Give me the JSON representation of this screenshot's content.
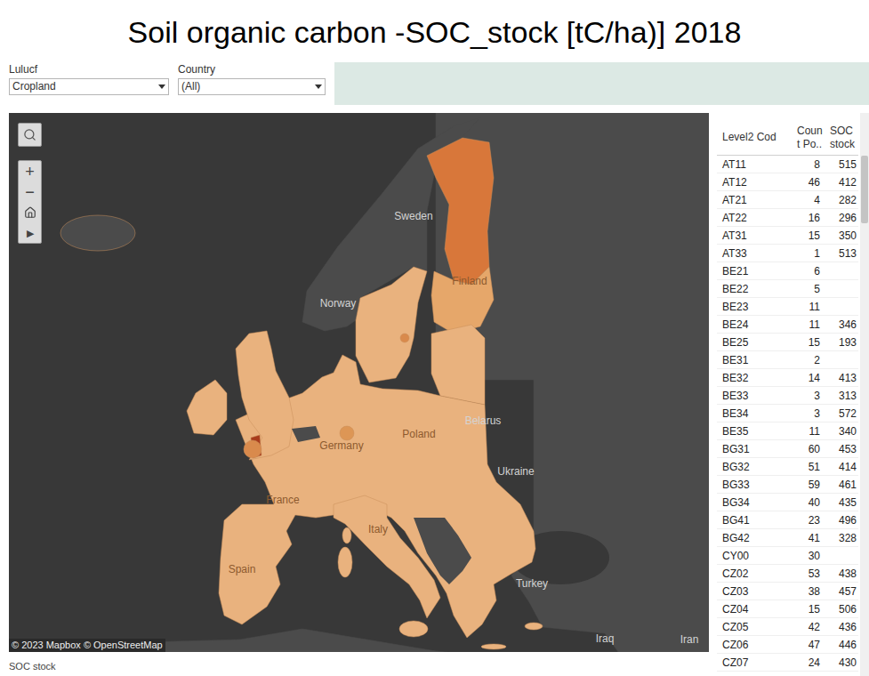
{
  "title": "Soil organic carbon -SOC_stock [tC/ha)] 2018",
  "filters": [
    {
      "label": "Lulucf",
      "value": "Cropland"
    },
    {
      "label": "Country",
      "value": "(All)"
    }
  ],
  "map": {
    "controls": {
      "zoom_in": "+",
      "zoom_out": "−",
      "play": "▶"
    },
    "attribution": "© 2023 Mapbox © OpenStreetMap",
    "regions": [
      {
        "color": "#d8773a"
      },
      {
        "color": "#e6a76a"
      },
      {
        "color": "#e9b27e"
      },
      {
        "color": "#e9b27e"
      },
      {
        "color": "#e9b27e"
      },
      {
        "color": "#e9b27e"
      },
      {
        "color": "#e9b27e"
      },
      {
        "color": "#e9b27e"
      },
      {
        "color": "#e9b27e"
      },
      {
        "color": "#e9b27e"
      },
      {
        "color": "#a83c1c"
      },
      {
        "color": "#e9b27e"
      },
      {
        "color": "#d98a4c"
      },
      {
        "color": "#dd9655"
      },
      {
        "color": "#d98a4c"
      },
      {
        "color": "#e9b27e"
      },
      {
        "color": "#e9b27e"
      }
    ],
    "labels": [
      {
        "text": "Sweden",
        "kind": "base"
      },
      {
        "text": "Norway",
        "kind": "base"
      },
      {
        "text": "Finland",
        "kind": "overlay"
      },
      {
        "text": "Belarus",
        "kind": "base"
      },
      {
        "text": "Ukraine",
        "kind": "base"
      },
      {
        "text": "Turkey",
        "kind": "base"
      },
      {
        "text": "Iraq",
        "kind": "base"
      },
      {
        "text": "Iran",
        "kind": "base"
      },
      {
        "text": "Germany",
        "kind": "overlay"
      },
      {
        "text": "Poland",
        "kind": "overlay"
      },
      {
        "text": "France",
        "kind": "overlay"
      },
      {
        "text": "Italy",
        "kind": "overlay"
      },
      {
        "text": "Spain",
        "kind": "overlay"
      }
    ]
  },
  "table": {
    "columns": [
      "Level2 Cod",
      "Count Po..",
      "SOC stock"
    ],
    "rows": [
      {
        "code": "AT11",
        "count": "8",
        "soc": "515"
      },
      {
        "code": "AT12",
        "count": "46",
        "soc": "412"
      },
      {
        "code": "AT21",
        "count": "4",
        "soc": "282"
      },
      {
        "code": "AT22",
        "count": "16",
        "soc": "296"
      },
      {
        "code": "AT31",
        "count": "15",
        "soc": "350"
      },
      {
        "code": "AT33",
        "count": "1",
        "soc": "513"
      },
      {
        "code": "BE21",
        "count": "6",
        "soc": ""
      },
      {
        "code": "BE22",
        "count": "5",
        "soc": ""
      },
      {
        "code": "BE23",
        "count": "11",
        "soc": ""
      },
      {
        "code": "BE24",
        "count": "11",
        "soc": "346"
      },
      {
        "code": "BE25",
        "count": "15",
        "soc": "193"
      },
      {
        "code": "BE31",
        "count": "2",
        "soc": ""
      },
      {
        "code": "BE32",
        "count": "14",
        "soc": "413"
      },
      {
        "code": "BE33",
        "count": "3",
        "soc": "313"
      },
      {
        "code": "BE34",
        "count": "3",
        "soc": "572"
      },
      {
        "code": "BE35",
        "count": "11",
        "soc": "340"
      },
      {
        "code": "BG31",
        "count": "60",
        "soc": "453"
      },
      {
        "code": "BG32",
        "count": "51",
        "soc": "414"
      },
      {
        "code": "BG33",
        "count": "59",
        "soc": "461"
      },
      {
        "code": "BG34",
        "count": "40",
        "soc": "435"
      },
      {
        "code": "BG41",
        "count": "23",
        "soc": "496"
      },
      {
        "code": "BG42",
        "count": "41",
        "soc": "328"
      },
      {
        "code": "CY00",
        "count": "30",
        "soc": ""
      },
      {
        "code": "CZ02",
        "count": "53",
        "soc": "438"
      },
      {
        "code": "CZ03",
        "count": "38",
        "soc": "457"
      },
      {
        "code": "CZ04",
        "count": "15",
        "soc": "506"
      },
      {
        "code": "CZ05",
        "count": "42",
        "soc": "436"
      },
      {
        "code": "CZ06",
        "count": "47",
        "soc": "446"
      },
      {
        "code": "CZ07",
        "count": "24",
        "soc": "430"
      }
    ]
  },
  "footer": "SOC stock"
}
